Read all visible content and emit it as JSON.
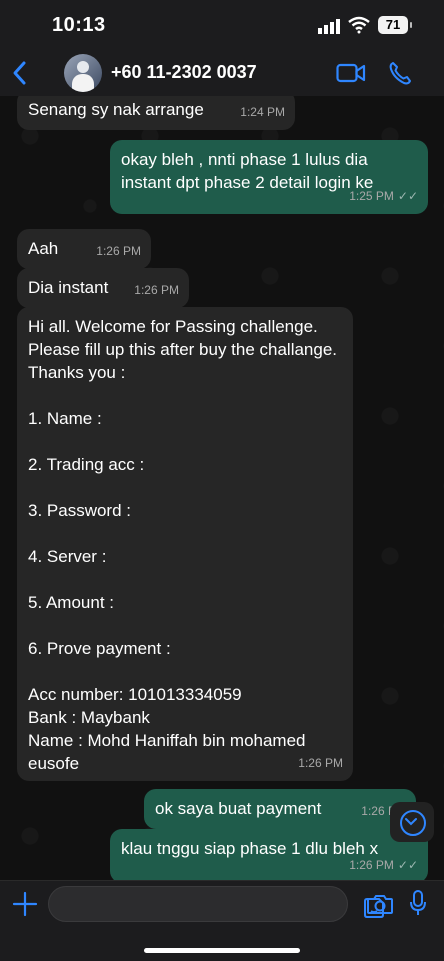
{
  "status_bar": {
    "time": "10:13",
    "battery": "71"
  },
  "header": {
    "contact_name": "+60 11-2302 0037"
  },
  "messages": [
    {
      "direction": "in",
      "text": "Senang sy nak arrange",
      "time": "1:24 PM"
    },
    {
      "direction": "out",
      "text": "okay bleh , nnti phase 1 lulus dia instant dpt phase 2 detail login ke",
      "time": "1:25 PM"
    },
    {
      "direction": "in",
      "text": "Aah",
      "time": "1:26 PM"
    },
    {
      "direction": "in",
      "text": "Dia instant",
      "time": "1:26 PM"
    },
    {
      "direction": "in",
      "text": "Hi all. Welcome for Passing challenge. Please fill up this after buy the challange. Thanks you :\n\n1. Name :\n\n2. Trading acc :\n\n3. Password :\n\n4. Server :\n\n5. Amount :\n\n6. Prove payment :\n\nAcc number: 101013334059\nBank : Maybank\nName : Mohd Haniffah bin mohamed eusofe",
      "time": "1:26 PM"
    },
    {
      "direction": "out",
      "text": "ok saya buat payment",
      "time": "1:26 PM"
    },
    {
      "direction": "out",
      "text": "klau tnggu siap phase 1 dlu bleh x",
      "time": "1:26 PM"
    }
  ],
  "colors": {
    "accent": "#2f86ff",
    "incoming_bubble": "#262626",
    "outgoing_bubble": "#1f5c4b"
  },
  "icons": {
    "back": "chevron-left-icon",
    "video": "video-camera-icon",
    "call": "phone-icon",
    "plus": "plus-icon",
    "sticker": "sticker-icon",
    "camera": "camera-icon",
    "mic": "microphone-icon",
    "scroll_down": "chevron-down-circle-icon"
  }
}
